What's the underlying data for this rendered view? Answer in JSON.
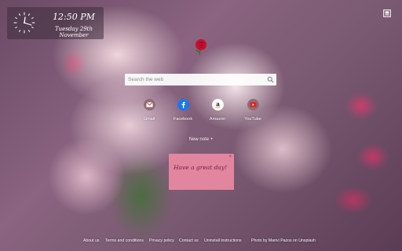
{
  "clock": {
    "time": "12:50 PM",
    "date": "Tuesday 29th November"
  },
  "header": {
    "settings_icon": "settings-icon"
  },
  "logo": {
    "icon": "rose-logo"
  },
  "search": {
    "placeholder": "Search the web",
    "icon": "search-icon"
  },
  "shortcuts": [
    {
      "label": "Gmail",
      "icon": "gmail-icon",
      "color": "#d14836"
    },
    {
      "label": "Facebook",
      "icon": "facebook-icon",
      "color": "#1877f2"
    },
    {
      "label": "Amazon",
      "icon": "amazon-icon",
      "color": "#ffffff"
    },
    {
      "label": "YouTube",
      "icon": "youtube-icon",
      "color": "#e62117"
    }
  ],
  "notes": {
    "new_note_label": "New note +",
    "items": [
      {
        "text": "Have a great day!",
        "close": "×",
        "color": "#f08ca5"
      }
    ]
  },
  "footer": {
    "links": [
      "About us",
      "Terms and conditions",
      "Privacy policy",
      "Contact us",
      "Uninstall instructions"
    ],
    "credit": "Photo by Marivi Pazos on Unsplash"
  }
}
